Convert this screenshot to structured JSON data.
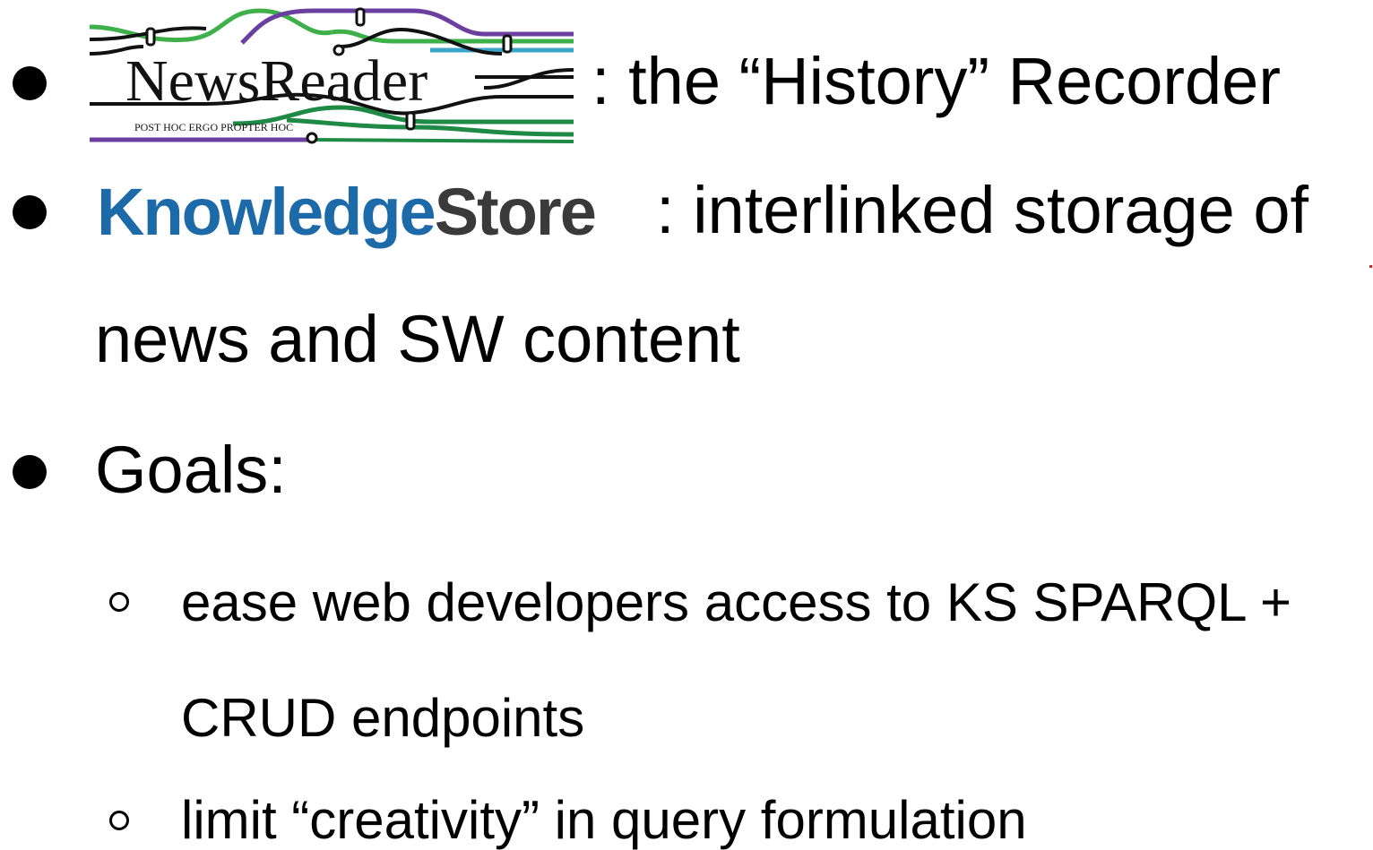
{
  "logos": {
    "newsreader": {
      "wordmark": "NewsReader",
      "tagline": "POST HOC ERGO PROPTER HOC",
      "colors": {
        "green": "#3db04a",
        "purple": "#6b3fa0",
        "teal": "#3aa6c9",
        "dark_green": "#1f8a45",
        "black": "#111111"
      }
    },
    "knowledgestore": {
      "part1": "Knowledge",
      "part2": "Store",
      "colors": {
        "part1": "#1c6aa8",
        "part2": "#3a3a3a"
      }
    }
  },
  "bullets": [
    {
      "text": ": the “History” Recorder"
    },
    {
      "text_line1": ": interlinked storage of",
      "text_line2": "news and SW content"
    },
    {
      "text": "Goals:"
    }
  ],
  "sub_bullets": [
    {
      "text_line1": "ease web developers access to KS SPARQL +",
      "text_line2": "CRUD endpoints"
    },
    {
      "text": "limit “creativity” in query formulation"
    }
  ]
}
